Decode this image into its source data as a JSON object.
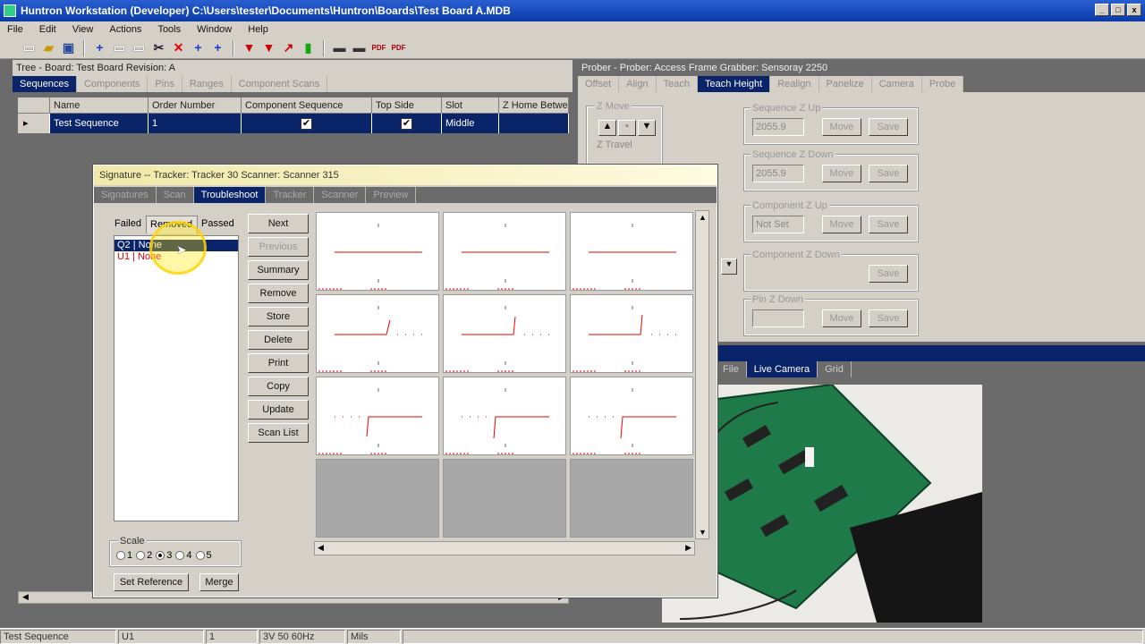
{
  "window": {
    "title": "Huntron Workstation (Developer) C:\\Users\\tester\\Documents\\Huntron\\Boards\\Test Board A.MDB",
    "min": "_",
    "max": "□",
    "close": "x"
  },
  "menu": [
    "File",
    "Edit",
    "View",
    "Actions",
    "Tools",
    "Window",
    "Help"
  ],
  "tree_panel": {
    "title": "Tree - Board: Test Board   Revision: A",
    "tabs": [
      "Sequences",
      "Components",
      "Pins",
      "Ranges",
      "Component Scans"
    ],
    "columns": [
      "Name",
      "Order Number",
      "Component Sequence",
      "Top Side",
      "Slot",
      "Z Home Betwe"
    ],
    "row": {
      "name": "Test Sequence",
      "order": "1",
      "component_sequence": "✔",
      "top_side": "✔",
      "slot": "Middle"
    },
    "row_marker": "▸"
  },
  "prober_panel": {
    "title": "Prober - Prober: Access Frame Grabber: Sensoray 2250",
    "tabs": [
      "Offset",
      "Align",
      "Teach",
      "Teach Height",
      "Realign",
      "Panelize",
      "Camera",
      "Probe"
    ],
    "zmove_label": "Z Move",
    "ztravel_label": "Z Travel",
    "groups": [
      {
        "label": "Sequence Z Up",
        "value": "2055.9",
        "move": "Move",
        "save": "Save"
      },
      {
        "label": "Sequence Z Down",
        "value": "2055.9",
        "move": "Move",
        "save": "Save"
      },
      {
        "label": "Component Z Up",
        "value": "Not Set",
        "move": "Move",
        "save": "Save"
      },
      {
        "label": "Component Z Down",
        "save": "Save"
      },
      {
        "label": "Pin Z Down",
        "value": "",
        "move": "Move",
        "save": "Save"
      }
    ]
  },
  "camera_panel": {
    "tabs": [
      "File",
      "Live Camera",
      "Grid"
    ]
  },
  "signature_window": {
    "title": "Signature -- Tracker: Tracker 30  Scanner: Scanner 315",
    "tabs": [
      "Signatures",
      "Scan",
      "Troubleshoot",
      "Tracker",
      "Scanner",
      "Preview"
    ],
    "list_tabs": [
      "Failed",
      "Removed",
      "Passed"
    ],
    "list_items": [
      {
        "label": "Q2 | None",
        "selected": true
      },
      {
        "label": "U1 | None",
        "selected": false
      }
    ],
    "buttons": [
      "Next",
      "Previous",
      "Summary",
      "Remove",
      "Store",
      "Delete",
      "Print",
      "Copy",
      "Update",
      "Scan List"
    ],
    "scale_label": "Scale",
    "scale_options": [
      "1",
      "2",
      "3",
      "4",
      "5"
    ],
    "scale_selected": "3",
    "set_reference": "Set Reference",
    "merge": "Merge"
  },
  "status_bar": [
    "Test Sequence",
    "U1",
    "1",
    "3V 50 60Hz",
    "Mils"
  ],
  "colors": {
    "selection": "#0a246a",
    "trace": "#e00000",
    "chrome": "#d4d0c8",
    "highlight": "#ffe600"
  }
}
